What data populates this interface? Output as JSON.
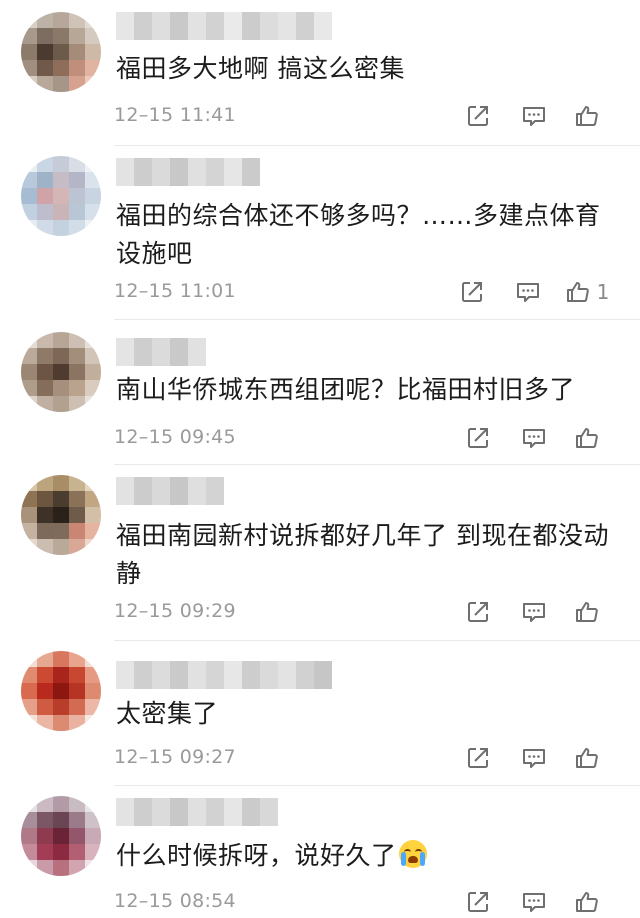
{
  "comments": [
    {
      "text": "福田多大地啊 搞这么密集",
      "time": "12–15 11:41",
      "likes": "",
      "avatar_colors": [
        "#d8cfc6",
        "#bdb2a6",
        "#b6a79a",
        "#cfc3b8",
        "#e2dbd4",
        "#a7998b",
        "#7d6d60",
        "#8a7869",
        "#b7a797",
        "#d4cabf",
        "#8c7a6a",
        "#4b3a30",
        "#6c5a4b",
        "#a48c78",
        "#cdb9a6",
        "#a08f80",
        "#70594a",
        "#8f6d5b",
        "#c08f7b",
        "#e0b4a0",
        "#d8cdc2",
        "#b7a89a",
        "#a69687",
        "#d7a18f",
        "#eec9b9"
      ],
      "username_colors": [
        "#e6e6e6",
        "#cfcfcf",
        "#dedede",
        "#c9c9c9",
        "#e2e2e2",
        "#d2d2d2",
        "#eaeaea",
        "#cccccc",
        "#dcdcdc",
        "#e4e4e4",
        "#d0d0d0",
        "#e8e8e8"
      ]
    },
    {
      "text": "福田的综合体还不够多吗？……多建点体育设施吧",
      "time": "12–15 11:01",
      "likes": "1",
      "avatar_colors": [
        "#e9eef3",
        "#c9d6e3",
        "#c6cbd8",
        "#d8dde6",
        "#eef1f5",
        "#b8c9db",
        "#9eb2c8",
        "#c6bcc6",
        "#b5b5c8",
        "#dae2ec",
        "#a6bcd3",
        "#cfa3a7",
        "#d3b6b5",
        "#bcc3d3",
        "#c8d4e1",
        "#c2d1e0",
        "#bdbdcd",
        "#c9b4b8",
        "#b8c6d6",
        "#d6e0ea",
        "#e6ecf2",
        "#d0dbe7",
        "#c4d2e0",
        "#d2dde8",
        "#edf1f5"
      ],
      "username_colors": [
        "#e3e3e3",
        "#cdcdcd",
        "#dadada",
        "#c8c8c8",
        "#e0e0e0",
        "#d4d4d4",
        "#e6e6e6",
        "#cbcbcb"
      ]
    },
    {
      "text": "南山华侨城东西组团呢？比福田村旧多了",
      "time": "12–15 09:45",
      "likes": "",
      "avatar_colors": [
        "#e3dcd6",
        "#c8b9ac",
        "#b7a595",
        "#cdbfb3",
        "#e6e0da",
        "#bba999",
        "#8f7a68",
        "#7e6756",
        "#a38d7b",
        "#d2c4b7",
        "#9b8573",
        "#6c5544",
        "#4f3b2f",
        "#8b7462",
        "#c1ae9d",
        "#b09c8a",
        "#846d5b",
        "#a6907d",
        "#b9a38f",
        "#d9cbbd",
        "#ddd3ca",
        "#c0b0a2",
        "#b3a190",
        "#cdbfb2",
        "#e8e1da"
      ],
      "username_colors": [
        "#e4e4e4",
        "#cecece",
        "#dbdbdb",
        "#c9c9c9",
        "#e1e1e1"
      ]
    },
    {
      "text": "福田南园新村说拆都好几年了 到现在都没动静",
      "time": "12–15 09:29",
      "likes": "",
      "avatar_colors": [
        "#d6c6a8",
        "#bca57c",
        "#a98d66",
        "#c7b38f",
        "#e3d6bf",
        "#8e7452",
        "#6d5640",
        "#4a3c2e",
        "#8a7157",
        "#c2a684",
        "#a8927a",
        "#3d3128",
        "#2a211b",
        "#6e5b49",
        "#d3bfa8",
        "#c5b2a1",
        "#7d6a5a",
        "#7e6b5c",
        "#c98672",
        "#e6b3a0",
        "#e4d9cf",
        "#cbbdb0",
        "#b9a998",
        "#d9a796",
        "#efd6ca"
      ],
      "username_colors": [
        "#e2e2e2",
        "#cccccc",
        "#d9d9d9",
        "#c7c7c7",
        "#dfdfdf",
        "#d3d3d3"
      ]
    },
    {
      "text": "太密集了",
      "time": "12–15 09:27",
      "likes": "",
      "avatar_colors": [
        "#f2dcd4",
        "#e7a891",
        "#d9775e",
        "#e9a48d",
        "#f3ddd5",
        "#e08a6f",
        "#cc4a31",
        "#a9241a",
        "#c84731",
        "#e79a83",
        "#d9694f",
        "#b82a1d",
        "#8c1710",
        "#b63424",
        "#dd8a71",
        "#e6a08a",
        "#cf5b42",
        "#b83d2b",
        "#d36a52",
        "#ecb7a6",
        "#f4e1da",
        "#ebb6a4",
        "#dc8a71",
        "#eab2a0",
        "#f6e8e2"
      ],
      "username_colors": [
        "#e5e5e5",
        "#cfcfcf",
        "#dcdcdc",
        "#cacaca",
        "#e1e1e1",
        "#d5d5d5",
        "#e7e7e7",
        "#cdcdcd",
        "#dadada",
        "#e3e3e3",
        "#d1d1d1",
        "#c6c6c6"
      ]
    },
    {
      "text": "什么时候拆呀，说好久了",
      "time": "12–15 08:54",
      "likes": "",
      "avatar_colors": [
        "#e6e0e3",
        "#cbbac2",
        "#b29aa6",
        "#c9bbc2",
        "#e9e4e6",
        "#a88e9b",
        "#7b5664",
        "#6a4654",
        "#9b7b89",
        "#cfc1c8",
        "#b07988",
        "#8e3b50",
        "#6b2338",
        "#93566a",
        "#c9a9b5",
        "#c48c9b",
        "#a33c55",
        "#8c2a41",
        "#b25f73",
        "#d8b3be",
        "#e8d6dc",
        "#c99aa7",
        "#b8707f",
        "#d1a4b0",
        "#efe3e7"
      ],
      "username_colors": [
        "#e3e3e3",
        "#cecece",
        "#dbdbdb",
        "#c8c8c8",
        "#e0e0e0",
        "#d2d2d2",
        "#e6e6e6",
        "#cbcbcb",
        "#d8d8d8"
      ]
    }
  ],
  "colors": {
    "icon": "#6f6f6f",
    "time": "#9a9a9a",
    "text": "#1c1c1c",
    "divider": "#e9e9e9"
  }
}
